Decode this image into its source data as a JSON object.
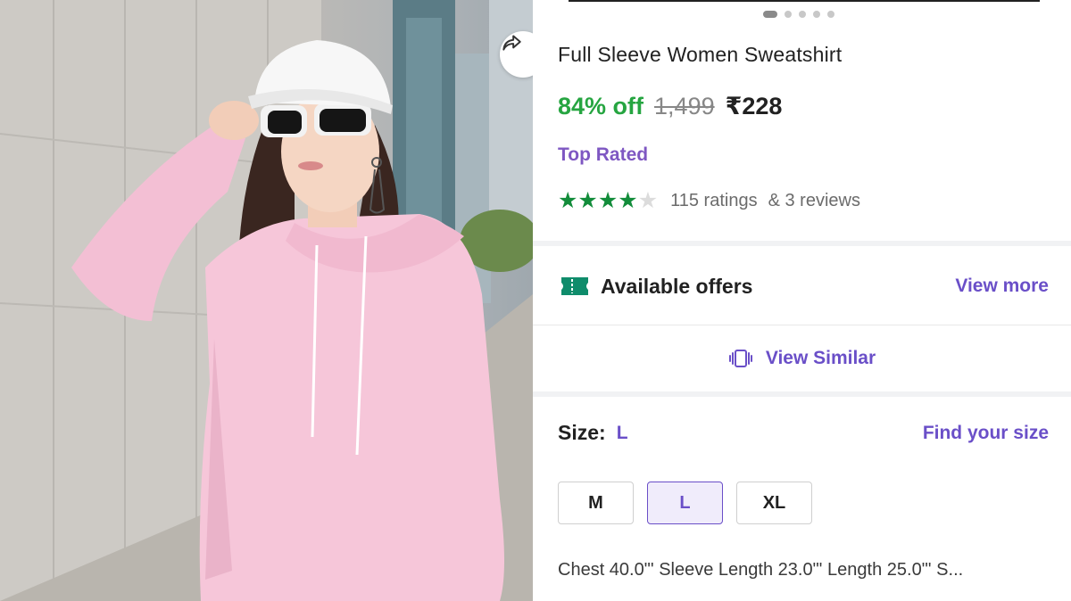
{
  "product": {
    "title": "Full Sleeve Women Sweatshirt",
    "discount": "84% off",
    "mrp": "1,499",
    "price": "₹228",
    "badge": "Top Rated",
    "rating": {
      "stars": 4,
      "out_of": 5,
      "ratings_text": "115 ratings",
      "reviews_text": "& 3 reviews"
    }
  },
  "carousel": {
    "dots": 5,
    "active_index": 0
  },
  "offers": {
    "label": "Available offers",
    "action": "View more",
    "icon": "offer-ticket-icon"
  },
  "similar": {
    "label": "View Similar",
    "icon": "view-similar-icon"
  },
  "size": {
    "label": "Size:",
    "selected": "L",
    "find_label": "Find your size",
    "options": [
      "M",
      "L",
      "XL"
    ],
    "measurements": "Chest 40.0\"'  Sleeve Length 23.0\"'  Length 25.0\"'  S..."
  },
  "icons": {
    "share": "share-icon"
  },
  "colors": {
    "discount_green": "#26a541",
    "accent_purple": "#6a4fc8",
    "badge_purple": "#7e57c2",
    "star_green": "#128c3a"
  }
}
